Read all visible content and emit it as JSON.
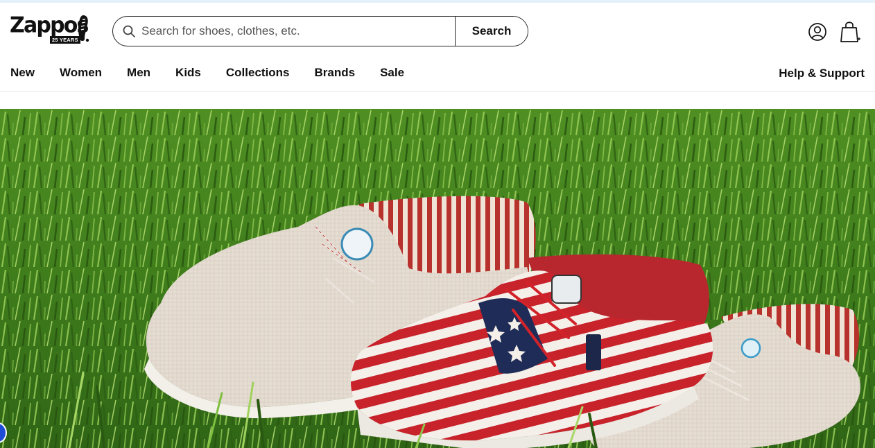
{
  "brand": {
    "name": "Zappos",
    "badge": "25 YEARS",
    "color": "#111111"
  },
  "search": {
    "placeholder": "Search for shoes, clothes, etc.",
    "value": "",
    "button_label": "Search",
    "icon": "search-icon"
  },
  "header_icons": {
    "account": "account-icon",
    "cart": "shopping-bag-icon"
  },
  "nav": {
    "items": [
      "New",
      "Women",
      "Men",
      "Kids",
      "Collections",
      "Brands",
      "Sale"
    ],
    "help": "Help & Support"
  },
  "hero": {
    "image": "three slip-on canvas shoes (two beige, one American-flag print) on green grass"
  },
  "colors": {
    "top_strip": "#e4f1fb",
    "accessibility_button": "#1f4cd6"
  }
}
